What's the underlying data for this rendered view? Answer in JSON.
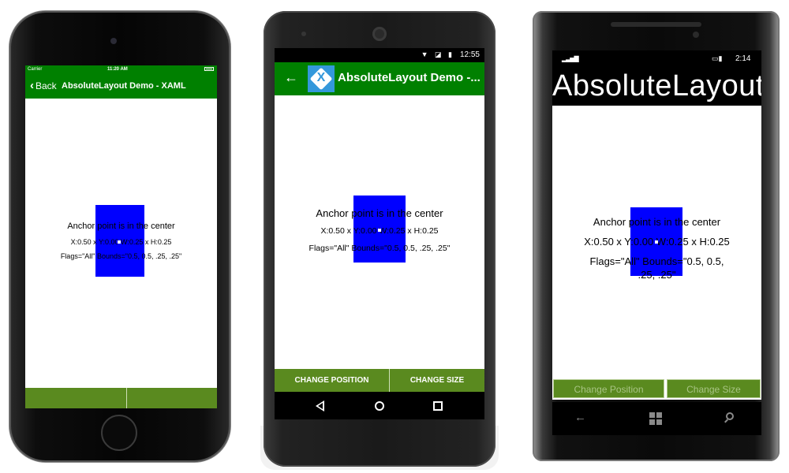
{
  "iphone": {
    "status": {
      "carrier": "Carrier",
      "time": "11:20 AM"
    },
    "nav": {
      "back_label": "Back",
      "title": "AbsoluteLayout Demo - XAML"
    },
    "label_line1": "Anchor point is in the center",
    "label_line2": "X:0.50 x Y:0.00 W:0.25 x H:0.25",
    "label_line3": "Flags=\"All\" Bounds=\"0.5, 0.5, .25, .25\"",
    "buttons": [
      "",
      ""
    ]
  },
  "android": {
    "status": {
      "time": "12:55",
      "icons": "▼ ◪ ▮"
    },
    "toolbar": {
      "logo_letter": "X",
      "title": "AbsoluteLayout Demo -..."
    },
    "label_line1": "Anchor point is in the center",
    "label_line2": "X:0.50 x Y:0.00 W:0.25 x H:0.25",
    "label_line3": "Flags=\"All\" Bounds=\"0.5, 0.5, .25, .25\"",
    "buttons": {
      "change_position": "CHANGE POSITION",
      "change_size": "CHANGE SIZE"
    }
  },
  "winphone": {
    "status": {
      "signal": "▂▃▅▇",
      "battery": "▭▮",
      "time": "2:14"
    },
    "title": "AbsoluteLayout",
    "label_line1": "Anchor point is in the center",
    "label_line2": "X:0.50 x Y:0.00 W:0.25 x H:0.25",
    "label_line3": "Flags=\"All\" Bounds=\"0.5, 0.5, .25, .25\"",
    "buttons": {
      "change_position": "Change Position",
      "change_size": "Change Size"
    }
  },
  "colors": {
    "nav_green": "#008000",
    "button_green": "#5a8a1f",
    "box_blue": "#0000ff"
  }
}
